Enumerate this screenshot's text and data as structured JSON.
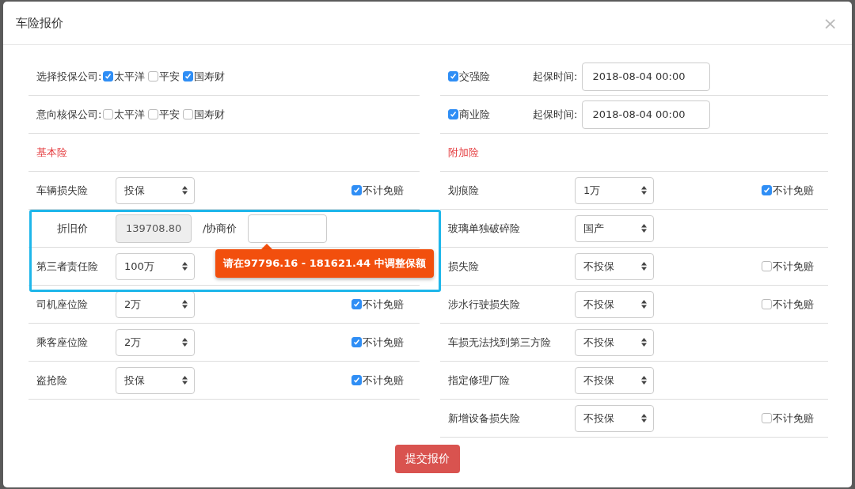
{
  "dialog": {
    "title": "车险报价",
    "close": "×"
  },
  "left": [
    {
      "kind": "company",
      "label": "选择投保公司:",
      "options": [
        {
          "label": "太平洋",
          "checked": true
        },
        {
          "label": "平安",
          "checked": false
        },
        {
          "label": "国寿财",
          "checked": true
        }
      ]
    },
    {
      "kind": "company",
      "label": "意向核保公司:",
      "options": [
        {
          "label": "太平洋",
          "checked": false
        },
        {
          "label": "平安",
          "checked": false
        },
        {
          "label": "国寿财",
          "checked": false
        }
      ]
    },
    {
      "kind": "section",
      "label": "基本险"
    },
    {
      "kind": "coverage",
      "label": "车辆损失险",
      "value": "投保",
      "deductible": {
        "label": "不计免赔",
        "checked": true
      }
    },
    {
      "kind": "price",
      "label": "折旧价",
      "value": "139708.80",
      "label_2": "/协商价"
    },
    {
      "kind": "coverage",
      "label": "第三者责任险",
      "value": "100万"
    },
    {
      "kind": "coverage",
      "label": "司机座位险",
      "value": "2万",
      "deductible": {
        "label": "不计免赔",
        "checked": true
      }
    },
    {
      "kind": "coverage",
      "label": "乘客座位险",
      "value": "2万",
      "deductible": {
        "label": "不计免赔",
        "checked": true
      }
    },
    {
      "kind": "coverage",
      "label": "盗抢险",
      "value": "投保",
      "deductible": {
        "label": "不计免赔",
        "checked": true
      }
    }
  ],
  "right": [
    {
      "kind": "policy",
      "label": "交强险",
      "checked": true,
      "date_label": "起保时间:",
      "date": "2018-08-04 00:00"
    },
    {
      "kind": "policy",
      "label": "商业险",
      "checked": true,
      "date_label": "起保时间:",
      "date": "2018-08-04 00:00"
    },
    {
      "kind": "section",
      "label": "附加险"
    },
    {
      "kind": "coverage",
      "label": "划痕险",
      "value": "1万",
      "deductible": {
        "label": "不计免赔",
        "checked": true
      }
    },
    {
      "kind": "coverage",
      "label": "玻璃单独破碎险",
      "value": "国产"
    },
    {
      "kind": "coverage",
      "label": "损失险",
      "value": "不投保",
      "deductible": {
        "label": "不计免赔",
        "checked": false
      }
    },
    {
      "kind": "coverage",
      "label": "涉水行驶损失险",
      "value": "不投保",
      "deductible": {
        "label": "不计免赔",
        "checked": false
      }
    },
    {
      "kind": "coverage",
      "label": "车损无法找到第三方险",
      "value": "不投保"
    },
    {
      "kind": "coverage",
      "label": "指定修理厂险",
      "value": "不投保"
    },
    {
      "kind": "coverage",
      "label": "新增设备损失险",
      "value": "不投保",
      "deductible": {
        "label": "不计免赔",
        "checked": false
      }
    }
  ],
  "tooltip": "请在97796.16 - 181621.44 中调整保额",
  "submit": "提交报价"
}
